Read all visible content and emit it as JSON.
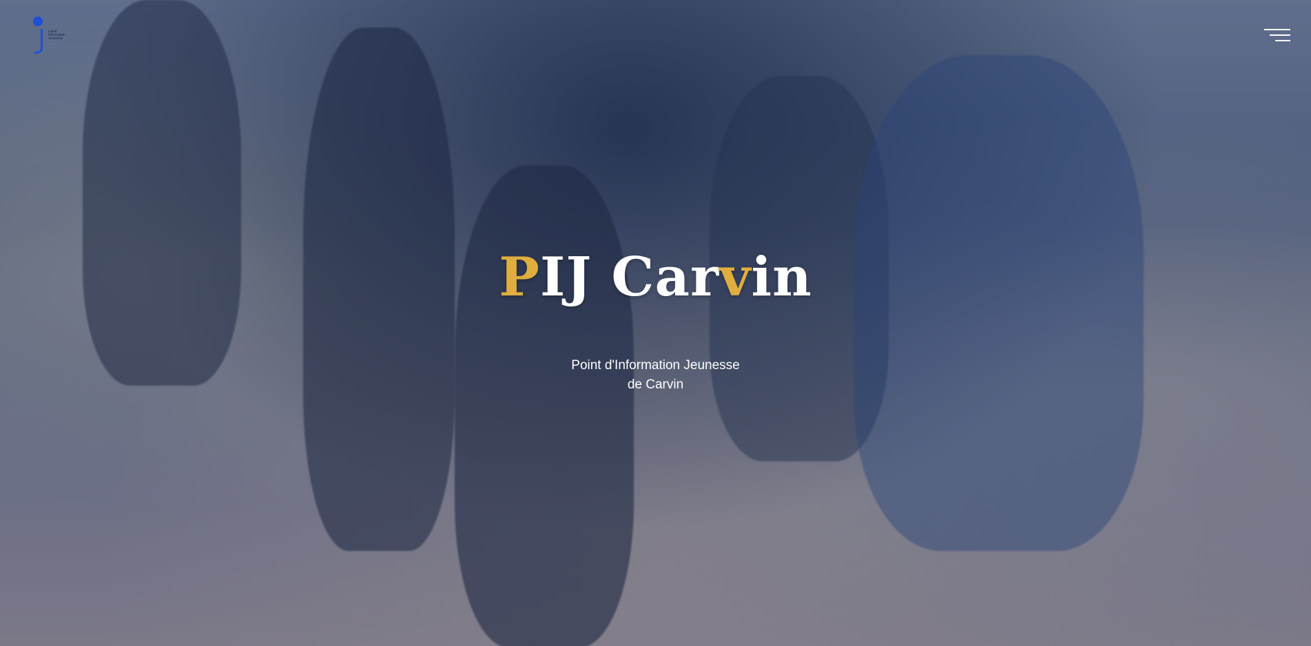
{
  "logo": {
    "icon": "info-i-logo",
    "caption": "Label Information Jeunesse"
  },
  "menu": {
    "icon": "hamburger-menu-icon"
  },
  "hero": {
    "title_p": "P",
    "title_ij": "IJ Ca",
    "title_r": "r",
    "title_v": "v",
    "title_in": "in",
    "subtitle_line1": "Point d'Information Jeunesse",
    "subtitle_line2": "de Carvin"
  },
  "colors": {
    "accent": "#e0ad3f",
    "logo_blue": "#1f4fd8"
  }
}
